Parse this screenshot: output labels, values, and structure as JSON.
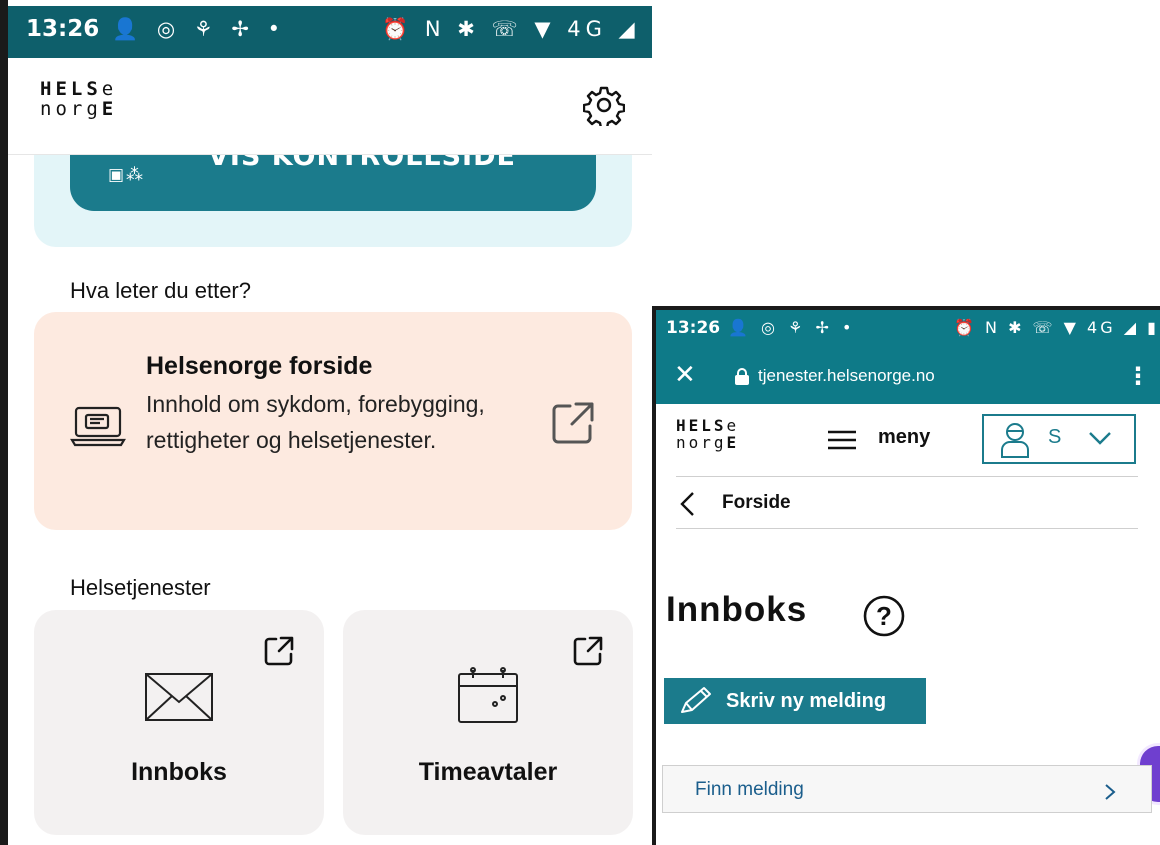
{
  "left_phone": {
    "status_bar": {
      "time": "13:26",
      "left_icons": "👤 ◎ ⚘ ✢ •",
      "right_icons": "⏰ N ✱ ☏ ▼ 4G ◢ ▮",
      "background": "#0e5f6b"
    },
    "header": {
      "logo_line1_regular": "HELS",
      "logo_line1_tail": "e",
      "logo_line2_regular": "norg",
      "logo_line2_tail": "E",
      "settings_icon": "gear-icon"
    },
    "kontrollside_button": {
      "label": "VIS KONTROLLSIDE",
      "icon": "qr-icon"
    },
    "search_section": {
      "title": "Hva leter du etter?"
    },
    "forside_card": {
      "title": "Helsenorge forside",
      "description": "Innhold om sykdom, forebygging, rettigheter og helsetjenester.",
      "icon": "laptop-icon",
      "link_icon": "external-link-icon"
    },
    "services_section": {
      "title": "Helsetjenester"
    },
    "service_tiles": [
      {
        "label": "Innboks",
        "icon": "envelope-icon"
      },
      {
        "label": "Timeavtaler",
        "icon": "calendar-icon"
      }
    ]
  },
  "right_phone": {
    "status_bar": {
      "time": "13:26",
      "left_icons": "👤 ◎ ⚘ ✢ •",
      "right_icons": "⏰ N ✱ ☏ ▼ 4G ◢ ▮"
    },
    "browser": {
      "close": "✕",
      "url": "tjenester.helsenorge.no",
      "menu": "⋮"
    },
    "header": {
      "logo_line1_regular": "HELS",
      "logo_line1_tail": "e",
      "logo_line2_regular": "norg",
      "logo_line2_tail": "E",
      "menu_label": "meny",
      "user_initial": "S"
    },
    "breadcrumb": {
      "back_label": "Forside"
    },
    "page_title": "Innboks",
    "help": "?",
    "new_message_button": "Skriv ny melding",
    "find_message": "Finn melding",
    "colors": {
      "accent": "#1b7b8c",
      "fab": "#6f3fcf"
    }
  }
}
